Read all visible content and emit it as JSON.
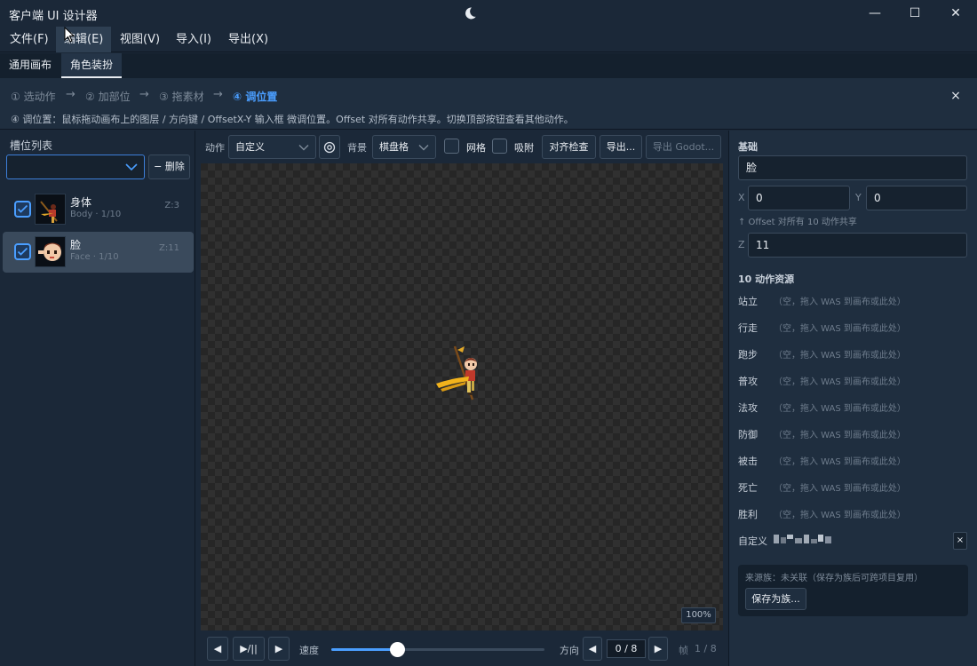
{
  "window": {
    "title": "客户端 UI 设计器",
    "controls": {
      "minimize": "—",
      "maximize": "☐",
      "close": "✕"
    }
  },
  "menu": [
    "文件(F)",
    "编辑(E)",
    "视图(V)",
    "导入(I)",
    "导出(X)"
  ],
  "tabs": [
    "通用画布",
    "角色装扮"
  ],
  "steps": {
    "items": [
      "① 选动作",
      "② 加部位",
      "③ 拖素材",
      "④ 调位置"
    ],
    "arrow": "→",
    "hint": "④ 调位置：鼠标拖动画布上的图层 / 方向键 / OffsetX-Y 输入框 微调位置。Offset 对所有动作共享。切换顶部按钮查看其他动作。",
    "close": "×"
  },
  "slots": {
    "title": "槽位列表",
    "select_value": "",
    "delete_label": "− 删除",
    "items": [
      {
        "name": "身体",
        "sub": "Body · 1/10",
        "z": "Z:3",
        "checked": true,
        "selected": false
      },
      {
        "name": "脸",
        "sub": "Face · 1/10",
        "z": "Z:11",
        "checked": true,
        "selected": true
      }
    ]
  },
  "toolbar": {
    "action_label": "动作",
    "action_value": "自定义",
    "bg_label": "背景",
    "bg_value": "棋盘格",
    "grid_label": "网格",
    "snap_label": "吸附",
    "align_check": "对齐检查",
    "export": "导出...",
    "export_godot": "导出 Godot..."
  },
  "canvas": {
    "zoom": "100%",
    "checkerboard_colors": [
      "#262626",
      "#303030"
    ]
  },
  "playback": {
    "prev": "◀",
    "playpause": "▶/||",
    "next": "▶",
    "speed_label": "速度",
    "speed_fraction": 0.31,
    "direction_label": "方向",
    "direction_prev": "◀",
    "direction_value": "0 / 8",
    "direction_next": "▶",
    "frame_label": "帧",
    "frame_value": "1 / 8"
  },
  "props": {
    "basic_heading": "基础",
    "name_value": "脸",
    "x_label": "X",
    "x_value": "0",
    "y_label": "Y",
    "y_value": "0",
    "offset_note": "↑ Offset 对所有 10 动作共享",
    "z_label": "Z",
    "z_value": "11",
    "actions_heading": "10 动作资源",
    "actions": [
      {
        "name": "站立",
        "value": "（空，拖入 WAS 到画布或此处）"
      },
      {
        "name": "行走",
        "value": "（空，拖入 WAS 到画布或此处）"
      },
      {
        "name": "跑步",
        "value": "（空，拖入 WAS 到画布或此处）"
      },
      {
        "name": "普攻",
        "value": "（空，拖入 WAS 到画布或此处）"
      },
      {
        "name": "法攻",
        "value": "（空，拖入 WAS 到画布或此处）"
      },
      {
        "name": "防御",
        "value": "（空，拖入 WAS 到画布或此处）"
      },
      {
        "name": "被击",
        "value": "（空，拖入 WAS 到画布或此处）"
      },
      {
        "name": "死亡",
        "value": "（空，拖入 WAS 到画布或此处）"
      },
      {
        "name": "胜利",
        "value": "（空，拖入 WAS 到画布或此处）"
      }
    ],
    "custom_label": "自定义",
    "custom_clear": "×",
    "family_status": "来源族：未关联（保存为族后可跨项目复用）",
    "save_family": "保存为族..."
  },
  "colors": {
    "accent": "#4a9eff",
    "bg": "#1b2838",
    "panel": "#1f2e3f"
  }
}
